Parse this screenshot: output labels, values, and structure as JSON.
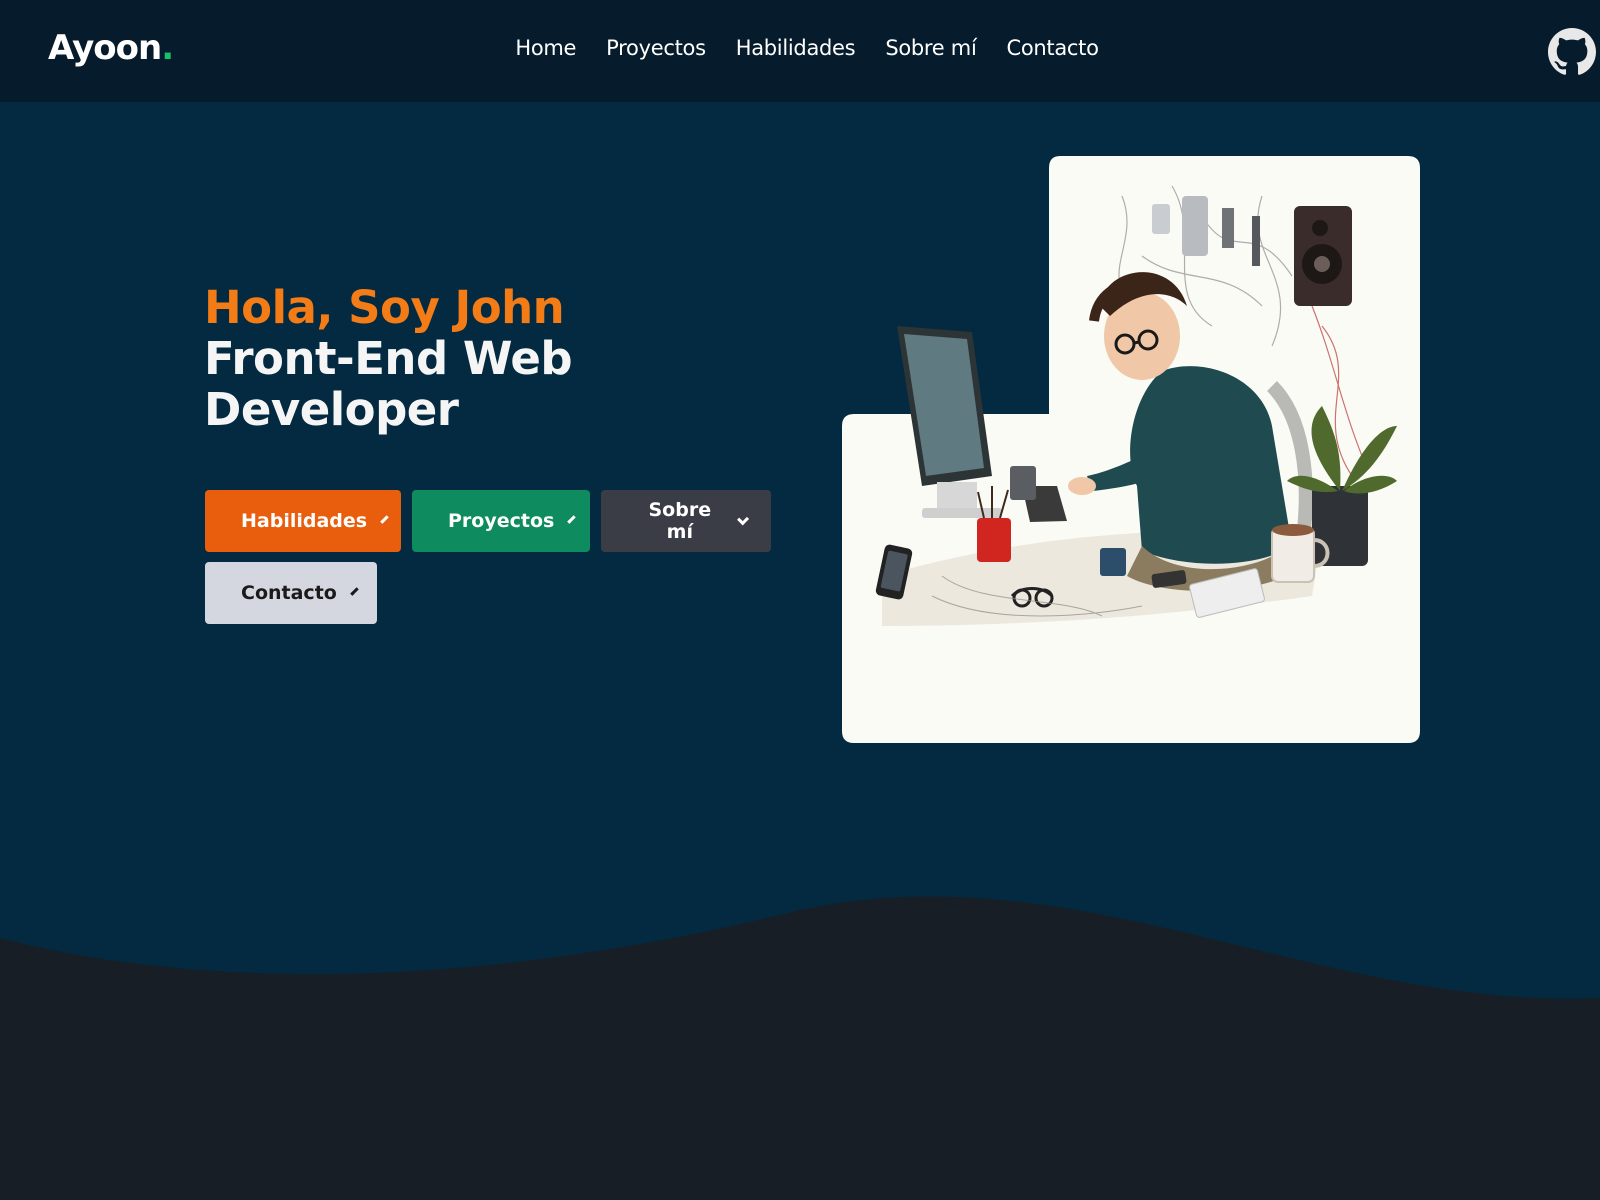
{
  "header": {
    "logo": {
      "text": "Ayoon",
      "dot": "."
    },
    "nav": [
      "Home",
      "Proyectos",
      "Habilidades",
      "Sobre mí",
      "Contacto"
    ],
    "github_icon": "github-icon"
  },
  "hero": {
    "greeting": "Hola, Soy John",
    "role": "Front-End Web Developer",
    "buttons": [
      {
        "label": "Habilidades",
        "color": "#e85e0c"
      },
      {
        "label": "Proyectos",
        "color": "#0e8c5f"
      },
      {
        "label": "Sobre mí",
        "color": "#3b3d46"
      },
      {
        "label": "Contacto",
        "color": "#d5d7e0"
      }
    ],
    "illustration": "developer-at-desk-illustration"
  },
  "colors": {
    "header_bg": "#061b2b",
    "hero_bg": "#032a40",
    "footer_bg": "#181e26",
    "accent_orange": "#f47c17",
    "accent_green": "#1bbf6b"
  }
}
